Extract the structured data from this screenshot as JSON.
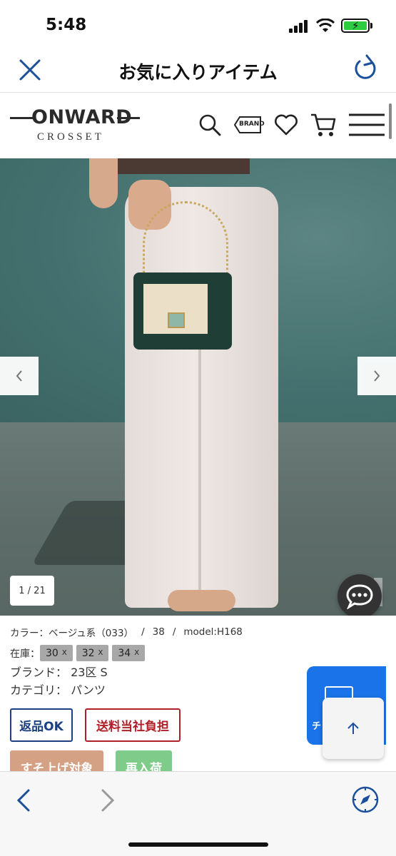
{
  "status_bar": {
    "time": "5:48"
  },
  "nav": {
    "title": "お気に入りアイテム"
  },
  "header": {
    "logo_main": "ONWARD",
    "logo_sub": "CROSSET",
    "brand_tag": "BRAND"
  },
  "hero": {
    "counter": "1 / 21"
  },
  "product": {
    "color": "カラー：ベージュ系（033）",
    "size": "38",
    "model": "model:H168",
    "stock_label": "在庫：",
    "stock_sizes": [
      "30",
      "32",
      "34"
    ],
    "remove_glyph": "X",
    "brand_line": "ブランド：  23区 S",
    "category_line": "カテゴリ：  パンツ",
    "separator": "/"
  },
  "tags": {
    "return": "返品OK",
    "shipping": "送料当社負担",
    "hem": "すそ上げ対象",
    "restock": "再入荷"
  },
  "side_panel": {
    "label": "チ"
  },
  "colors": {
    "accent_blue": "#1a73e8",
    "nav_blue": "#1b4f9c",
    "return_border": "#1b3f80",
    "ship_border": "#b02028",
    "hem_bg": "#d4a184",
    "restock_bg": "#7fcc8a"
  }
}
